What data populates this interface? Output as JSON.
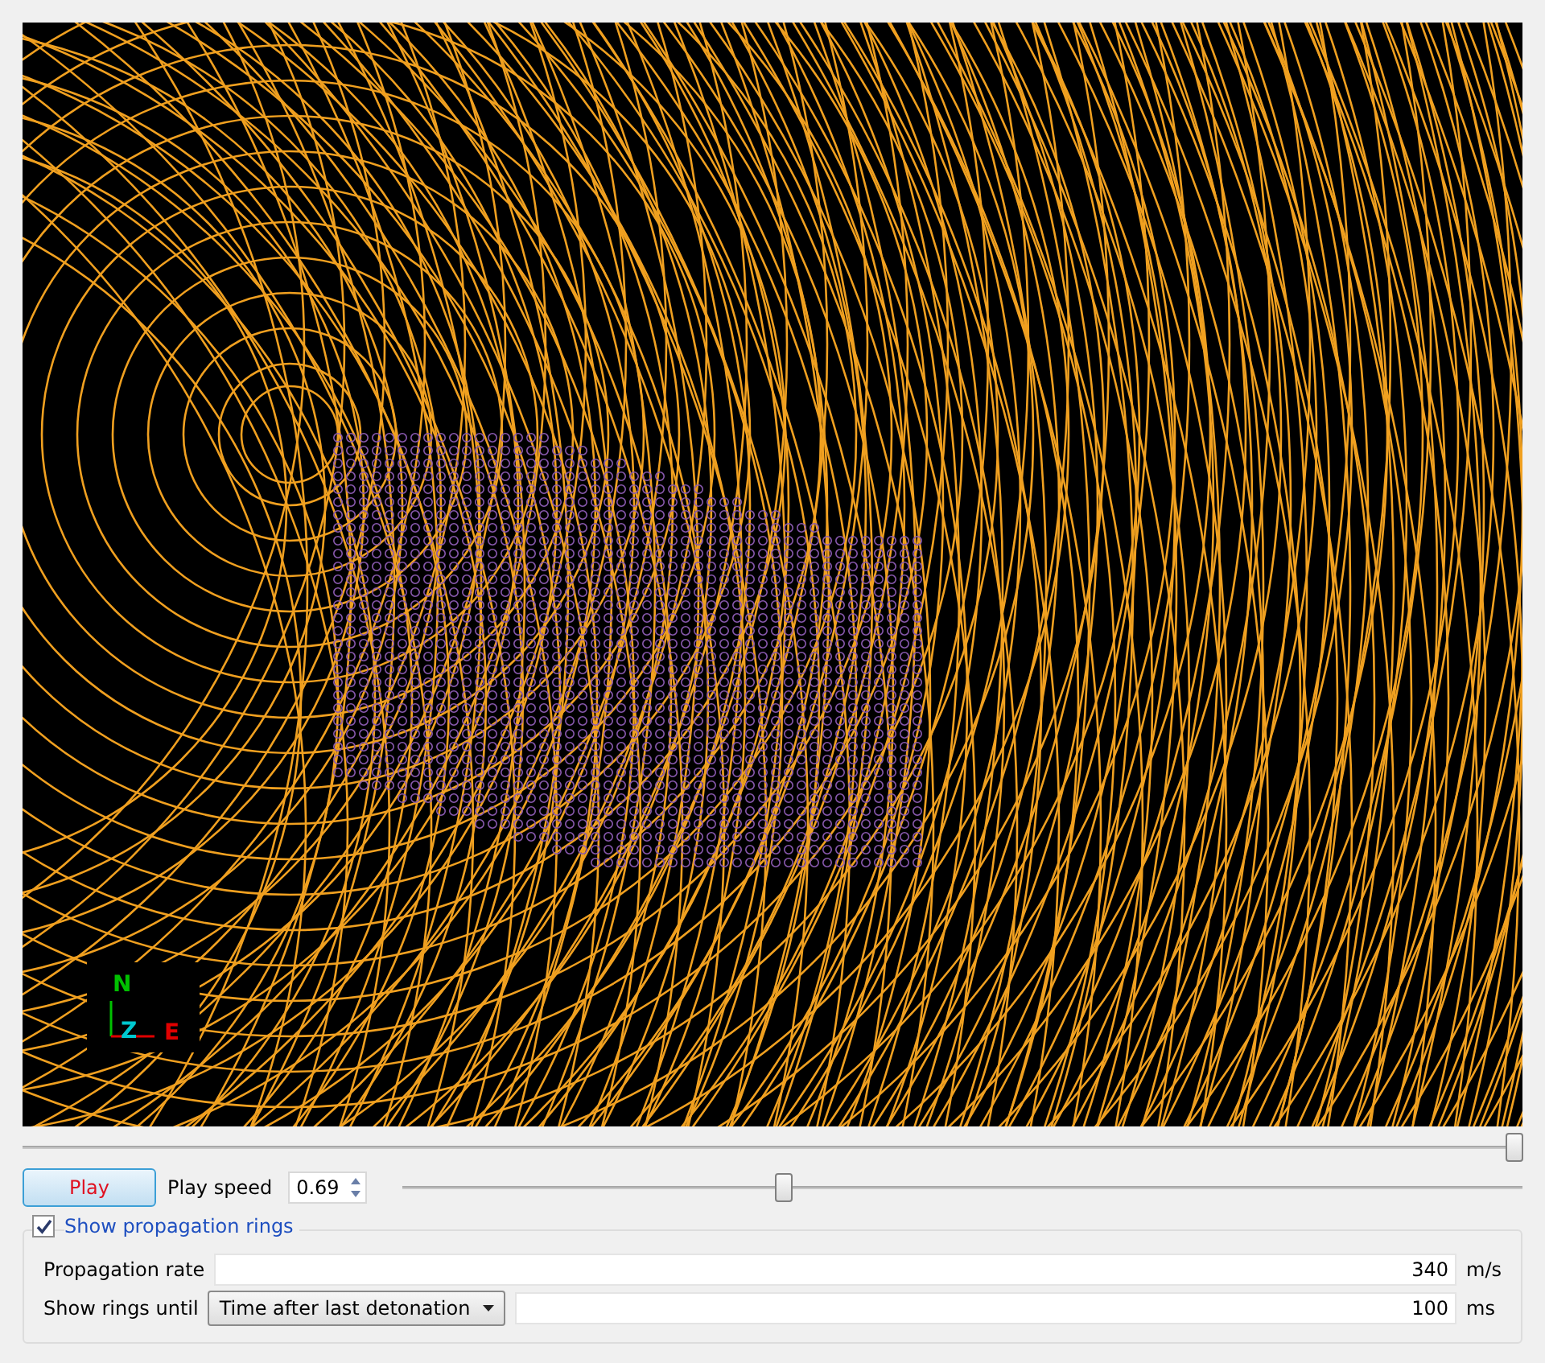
{
  "viewport": {
    "axes": [
      {
        "label": "N",
        "color": "#00c000"
      },
      {
        "label": "Z",
        "color": "#00c8d0"
      },
      {
        "label": "E",
        "color": "#e00000"
      }
    ]
  },
  "timeline": {
    "level": 0.995
  },
  "playback": {
    "play_button": "Play",
    "speed_label": "Play speed",
    "speed_value": "0.69",
    "speed_slider": {
      "level": 0.34
    }
  },
  "rings_group": {
    "checked": true,
    "label": "Show propagation rings",
    "rows": [
      {
        "kind": "field",
        "label": "Propagation rate",
        "value": "340",
        "unit": "m/s"
      },
      {
        "kind": "select_field",
        "label": "Show rings until",
        "select": "Time after last detonation",
        "value": "100",
        "unit": "ms"
      }
    ]
  }
}
